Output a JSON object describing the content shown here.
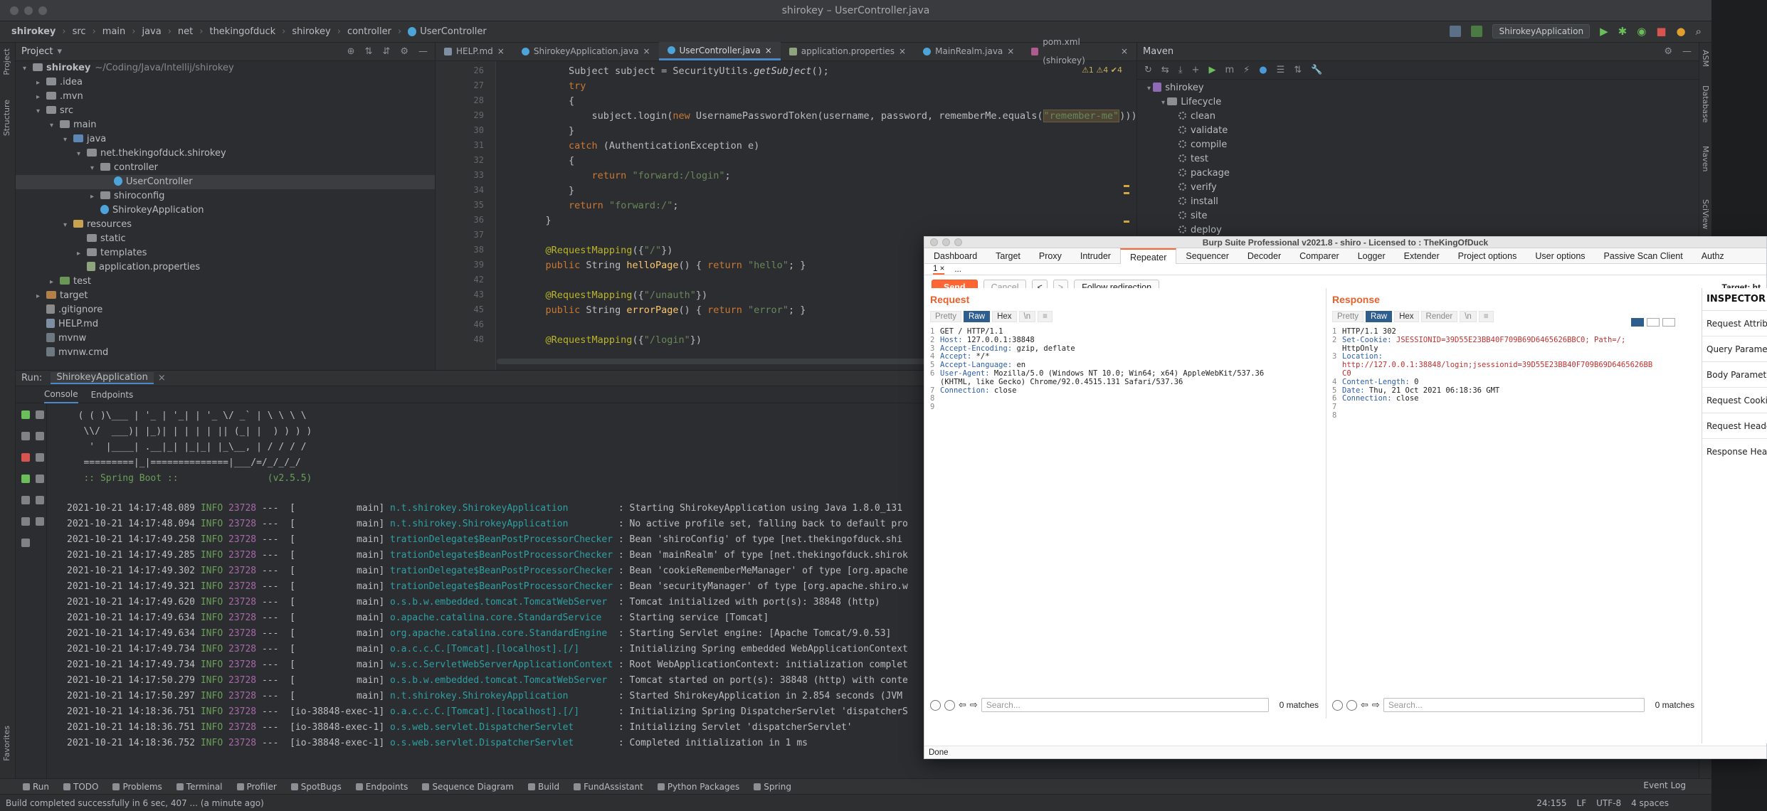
{
  "ide": {
    "window_title": "shirokey – UserController.java",
    "breadcrumb": [
      "shirokey",
      "src",
      "main",
      "java",
      "net",
      "thekingofduck",
      "shirokey",
      "controller",
      "UserController"
    ],
    "run_config": "ShirokeyApplication",
    "project_panel": {
      "title": "Project",
      "tree": [
        {
          "label": "shirokey",
          "note": "~/Coding/Java/Intellij/shirokey",
          "depth": 0,
          "kind": "root",
          "open": true
        },
        {
          "label": ".idea",
          "depth": 1,
          "kind": "folder",
          "open": false
        },
        {
          "label": ".mvn",
          "depth": 1,
          "kind": "folder",
          "open": false
        },
        {
          "label": "src",
          "depth": 1,
          "kind": "folder",
          "open": true
        },
        {
          "label": "main",
          "depth": 2,
          "kind": "folder",
          "open": true
        },
        {
          "label": "java",
          "depth": 3,
          "kind": "src",
          "open": true
        },
        {
          "label": "net.thekingofduck.shirokey",
          "depth": 4,
          "kind": "folder",
          "open": true
        },
        {
          "label": "controller",
          "depth": 5,
          "kind": "folder",
          "open": true
        },
        {
          "label": "UserController",
          "depth": 6,
          "kind": "class",
          "selected": true
        },
        {
          "label": "shiroconfig",
          "depth": 5,
          "kind": "folder",
          "open": false
        },
        {
          "label": "ShirokeyApplication",
          "depth": 5,
          "kind": "class"
        },
        {
          "label": "resources",
          "depth": 3,
          "kind": "res",
          "open": true
        },
        {
          "label": "static",
          "depth": 4,
          "kind": "folder"
        },
        {
          "label": "templates",
          "depth": 4,
          "kind": "folder",
          "open": false
        },
        {
          "label": "application.properties",
          "depth": 4,
          "kind": "props"
        },
        {
          "label": "test",
          "depth": 2,
          "kind": "tst",
          "open": false
        },
        {
          "label": "target",
          "depth": 1,
          "kind": "tgt",
          "open": false
        },
        {
          "label": ".gitignore",
          "depth": 1,
          "kind": "git"
        },
        {
          "label": "HELP.md",
          "depth": 1,
          "kind": "md"
        },
        {
          "label": "mvnw",
          "depth": 1,
          "kind": "sh"
        },
        {
          "label": "mvnw.cmd",
          "depth": 1,
          "kind": "sh"
        }
      ]
    },
    "editor_tabs": [
      {
        "label": "HELP.md",
        "kind": "md"
      },
      {
        "label": "ShirokeyApplication.java",
        "kind": "class"
      },
      {
        "label": "UserController.java",
        "kind": "class",
        "active": true
      },
      {
        "label": "application.properties",
        "kind": "pr"
      },
      {
        "label": "MainRealm.java",
        "kind": "class"
      },
      {
        "label": "pom.xml (shirokey)",
        "kind": "m"
      }
    ],
    "inspections": "⚠1 ⚠4 ✔4",
    "gutter_numbers": [
      "26",
      "27",
      "28",
      "29",
      "30",
      "31",
      "32",
      "33",
      "34",
      "35",
      "36",
      "37",
      "38",
      "39",
      "42",
      "43",
      "45",
      "46",
      "48"
    ],
    "code": [
      {
        "n": "26",
        "html": "        Subject subject = SecurityUtils.<i>getSubject</i>();"
      },
      {
        "n": "27",
        "html": "        try"
      },
      {
        "n": "28",
        "html": "        {"
      },
      {
        "n": "29",
        "html": "            subject.login(new UsernamePasswordToken(username, password, rememberMe.equals(\"remember-me\")));"
      },
      {
        "n": "30",
        "html": "        }"
      },
      {
        "n": "31",
        "html": "        catch (AuthenticationException e)"
      },
      {
        "n": "32",
        "html": "        {"
      },
      {
        "n": "33",
        "html": "            return \"forward:/login\";"
      },
      {
        "n": "34",
        "html": "        }"
      },
      {
        "n": "35",
        "html": "        return \"forward:/\";"
      },
      {
        "n": "36",
        "html": "    }"
      },
      {
        "n": "37",
        "html": ""
      },
      {
        "n": "38",
        "html": "    @RequestMapping({\"/\"})"
      },
      {
        "n": "39",
        "html": "    public String helloPage() { return \"hello\"; }"
      },
      {
        "n": "42",
        "html": ""
      },
      {
        "n": "43",
        "html": "    @RequestMapping({\"/unauth\"})"
      },
      {
        "n": "45",
        "html": "    public String errorPage() { return \"error\"; }"
      },
      {
        "n": "46",
        "html": ""
      },
      {
        "n": "48",
        "html": "    @RequestMapping({\"/login\"})"
      }
    ],
    "maven": {
      "title": "Maven",
      "project": "shirokey",
      "lifecycle_label": "Lifecycle",
      "goals": [
        "clean",
        "validate",
        "compile",
        "test",
        "package",
        "verify",
        "install",
        "site",
        "deploy"
      ]
    },
    "run_panel": {
      "label": "Run:",
      "config": "ShirokeyApplication",
      "tabs": [
        "Console",
        "Endpoints"
      ],
      "banner": [
        "  ( ( )\\___ | '_ | '_| | '_ \\/ _` | \\ \\ \\ \\",
        "   \\\\/  ___)| |_)| | | | | || (_| |  ) ) ) )",
        "    '  |____| .__|_| |_|_| |_\\__, | / / / /",
        "   =========|_|==============|___/=/_/_/_/",
        "   :: Spring Boot ::                (v2.5.5)"
      ],
      "logs": [
        {
          "ts": "2021-10-21 14:17:48.089",
          "lvl": "INFO",
          "pid": "23728",
          "thread": "---  [           main]",
          "cls": "n.t.shirokey.ShirokeyApplication        ",
          "msg": ": Starting ShirokeyApplication using Java 1.8.0_131"
        },
        {
          "ts": "2021-10-21 14:17:48.094",
          "lvl": "INFO",
          "pid": "23728",
          "thread": "---  [           main]",
          "cls": "n.t.shirokey.ShirokeyApplication        ",
          "msg": ": No active profile set, falling back to default pro"
        },
        {
          "ts": "2021-10-21 14:17:49.258",
          "lvl": "INFO",
          "pid": "23728",
          "thread": "---  [           main]",
          "cls": "trationDelegate$BeanPostProcessorChecker",
          "msg": ": Bean 'shiroConfig' of type [net.thekingofduck.shi"
        },
        {
          "ts": "2021-10-21 14:17:49.285",
          "lvl": "INFO",
          "pid": "23728",
          "thread": "---  [           main]",
          "cls": "trationDelegate$BeanPostProcessorChecker",
          "msg": ": Bean 'mainRealm' of type [net.thekingofduck.shirok"
        },
        {
          "ts": "2021-10-21 14:17:49.302",
          "lvl": "INFO",
          "pid": "23728",
          "thread": "---  [           main]",
          "cls": "trationDelegate$BeanPostProcessorChecker",
          "msg": ": Bean 'cookieRememberMeManager' of type [org.apache"
        },
        {
          "ts": "2021-10-21 14:17:49.321",
          "lvl": "INFO",
          "pid": "23728",
          "thread": "---  [           main]",
          "cls": "trationDelegate$BeanPostProcessorChecker",
          "msg": ": Bean 'securityManager' of type [org.apache.shiro.w"
        },
        {
          "ts": "2021-10-21 14:17:49.620",
          "lvl": "INFO",
          "pid": "23728",
          "thread": "---  [           main]",
          "cls": "o.s.b.w.embedded.tomcat.TomcatWebServer ",
          "msg": ": Tomcat initialized with port(s): 38848 (http)"
        },
        {
          "ts": "2021-10-21 14:17:49.634",
          "lvl": "INFO",
          "pid": "23728",
          "thread": "---  [           main]",
          "cls": "o.apache.catalina.core.StandardService  ",
          "msg": ": Starting service [Tomcat]"
        },
        {
          "ts": "2021-10-21 14:17:49.634",
          "lvl": "INFO",
          "pid": "23728",
          "thread": "---  [           main]",
          "cls": "org.apache.catalina.core.StandardEngine ",
          "msg": ": Starting Servlet engine: [Apache Tomcat/9.0.53]"
        },
        {
          "ts": "2021-10-21 14:17:49.734",
          "lvl": "INFO",
          "pid": "23728",
          "thread": "---  [           main]",
          "cls": "o.a.c.c.C.[Tomcat].[localhost].[/]      ",
          "msg": ": Initializing Spring embedded WebApplicationContext"
        },
        {
          "ts": "2021-10-21 14:17:49.734",
          "lvl": "INFO",
          "pid": "23728",
          "thread": "---  [           main]",
          "cls": "w.s.c.ServletWebServerApplicationContext",
          "msg": ": Root WebApplicationContext: initialization complet"
        },
        {
          "ts": "2021-10-21 14:17:50.279",
          "lvl": "INFO",
          "pid": "23728",
          "thread": "---  [           main]",
          "cls": "o.s.b.w.embedded.tomcat.TomcatWebServer ",
          "msg": ": Tomcat started on port(s): 38848 (http) with conte"
        },
        {
          "ts": "2021-10-21 14:17:50.297",
          "lvl": "INFO",
          "pid": "23728",
          "thread": "---  [           main]",
          "cls": "n.t.shirokey.ShirokeyApplication        ",
          "msg": ": Started ShirokeyApplication in 2.854 seconds (JVM"
        },
        {
          "ts": "2021-10-21 14:18:36.751",
          "lvl": "INFO",
          "pid": "23728",
          "thread": "---  [io-38848-exec-1]",
          "cls": "o.a.c.c.C.[Tomcat].[localhost].[/]      ",
          "msg": ": Initializing Spring DispatcherServlet 'dispatcherS"
        },
        {
          "ts": "2021-10-21 14:18:36.751",
          "lvl": "INFO",
          "pid": "23728",
          "thread": "---  [io-38848-exec-1]",
          "cls": "o.s.web.servlet.DispatcherServlet       ",
          "msg": ": Initializing Servlet 'dispatcherServlet'"
        },
        {
          "ts": "2021-10-21 14:18:36.752",
          "lvl": "INFO",
          "pid": "23728",
          "thread": "---  [io-38848-exec-1]",
          "cls": "o.s.web.servlet.DispatcherServlet       ",
          "msg": ": Completed initialization in 1 ms"
        }
      ]
    },
    "bottom_tools": [
      "Run",
      "TODO",
      "Problems",
      "Terminal",
      "Profiler",
      "SpotBugs",
      "Endpoints",
      "Sequence Diagram",
      "Build",
      "FundAssistant",
      "Python Packages",
      "Spring"
    ],
    "event_log": "Event Log",
    "status_left": "Build completed successfully in 6 sec, 407 ... (a minute ago)",
    "status_right": [
      "24:155",
      "LF",
      "UTF-8",
      "4 spaces"
    ],
    "left_strip": [
      "Project",
      "Structure",
      "Favorites"
    ],
    "right_strip": [
      "ASM",
      "Database",
      "Maven",
      "SciView"
    ]
  },
  "burp": {
    "title": "Burp Suite Professional v2021.8 - shiro - Licensed to : TheKingOfDuck",
    "menu": [
      "Dashboard",
      "Target",
      "Proxy",
      "Intruder",
      "Repeater",
      "Sequencer",
      "Decoder",
      "Comparer",
      "Logger",
      "Extender",
      "Project options",
      "User options",
      "Passive Scan Client",
      "Authz"
    ],
    "active_menu": "Repeater",
    "subtabs": [
      "1 ×",
      "..."
    ],
    "toolbar": {
      "send": "Send",
      "cancel": "Cancel",
      "back": "<",
      "fwd": ">",
      "follow": "Follow redirection",
      "target": "Target: ht"
    },
    "request": {
      "title": "Request",
      "tabs": [
        "Pretty",
        "Raw",
        "Hex",
        "\\n",
        "≡"
      ],
      "lines": [
        {
          "n": "1",
          "k": "GET / HTTP/1.1",
          "v": ""
        },
        {
          "n": "2",
          "k": "Host:",
          "v": " 127.0.0.1:38848"
        },
        {
          "n": "3",
          "k": "Accept-Encoding:",
          "v": " gzip, deflate"
        },
        {
          "n": "4",
          "k": "Accept:",
          "v": " */*"
        },
        {
          "n": "5",
          "k": "Accept-Language:",
          "v": " en"
        },
        {
          "n": "6",
          "k": "User-Agent:",
          "v": " Mozilla/5.0 (Windows NT 10.0; Win64; x64) AppleWebKit/537.36"
        },
        {
          "n": "",
          "k": "",
          "v": "(KHTML, like Gecko) Chrome/92.0.4515.131 Safari/537.36"
        },
        {
          "n": "7",
          "k": "Connection:",
          "v": " close"
        },
        {
          "n": "8",
          "k": "",
          "v": ""
        },
        {
          "n": "9",
          "k": "",
          "v": ""
        }
      ],
      "search_placeholder": "Search...",
      "matches": "0 matches"
    },
    "response": {
      "title": "Response",
      "tabs": [
        "Pretty",
        "Raw",
        "Hex",
        "Render",
        "\\n",
        "≡"
      ],
      "lines": [
        {
          "n": "1",
          "k": "HTTP/1.1 302",
          "v": ""
        },
        {
          "n": "2",
          "k": "Set-Cookie:",
          "v": " JSESSIONID=39D55E23BB40F709B69D6465626BBC0; Path=/;"
        },
        {
          "n": "",
          "k": "",
          "v": "HttpOnly"
        },
        {
          "n": "3",
          "k": "Location:",
          "v": ""
        },
        {
          "n": "",
          "k": "",
          "v": "http://127.0.0.1:38848/login;jsessionid=39D55E23BB40F709B69D6465626BB"
        },
        {
          "n": "",
          "k": "",
          "v": "C0"
        },
        {
          "n": "4",
          "k": "Content-Length:",
          "v": " 0"
        },
        {
          "n": "5",
          "k": "Date:",
          "v": " Thu, 21 Oct 2021 06:18:36 GMT"
        },
        {
          "n": "6",
          "k": "Connection:",
          "v": " close"
        },
        {
          "n": "7",
          "k": "",
          "v": ""
        },
        {
          "n": "8",
          "k": "",
          "v": ""
        }
      ],
      "search_placeholder": "Search...",
      "matches": "0 matches"
    },
    "inspector": {
      "title": "INSPECTOR",
      "items": [
        "Request Attributes",
        "Query Parameters",
        "Body Parameters",
        "Request Cookies",
        "Request Headers",
        "Response Headers"
      ]
    },
    "status": "Done"
  }
}
